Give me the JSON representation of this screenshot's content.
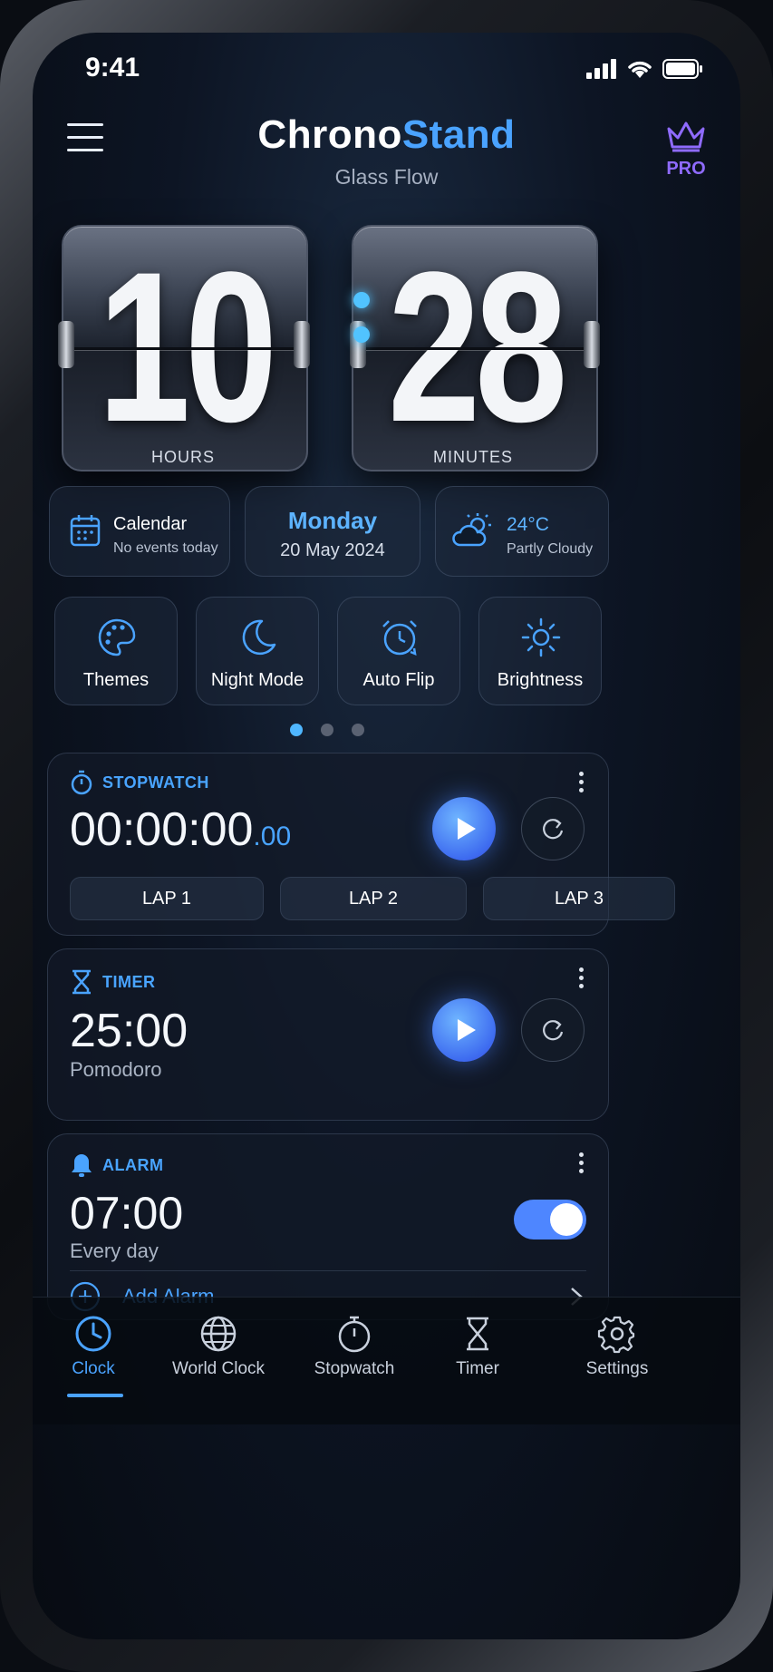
{
  "status_bar": {
    "time": "9:41"
  },
  "header": {
    "brand_part1": "Chrono",
    "brand_part2": "Stand",
    "subtitle": "Glass Flow",
    "pro_label": "PRO"
  },
  "clock": {
    "hours": "10",
    "minutes": "28",
    "hours_label": "HOURS",
    "minutes_label": "MINUTES"
  },
  "info_cards": {
    "calendar": {
      "title": "Calendar",
      "subtitle": "No events today"
    },
    "date": {
      "day": "Monday",
      "date": "20 May 2024"
    },
    "weather": {
      "temp": "24°C",
      "condition": "Partly Cloudy"
    }
  },
  "quick_actions": [
    {
      "label": "Themes",
      "icon": "palette-icon"
    },
    {
      "label": "Night Mode",
      "icon": "moon-icon"
    },
    {
      "label": "Auto Flip",
      "icon": "auto-flip-icon"
    },
    {
      "label": "Brightness",
      "icon": "sun-icon"
    }
  ],
  "pager": {
    "pages": 3,
    "active": 1
  },
  "stopwatch": {
    "title": "STOPWATCH",
    "time": "00:00:00",
    "fraction": ".00",
    "laps": [
      "LAP 1",
      "LAP 2",
      "LAP 3"
    ]
  },
  "timer": {
    "title": "TIMER",
    "time": "25:00",
    "preset": "Pomodoro"
  },
  "alarm": {
    "title": "ALARM",
    "time": "07:00",
    "repeat": "Every day",
    "enabled": true,
    "add_label": "Add Alarm"
  },
  "tabs": [
    {
      "label": "Clock",
      "icon": "clock-icon",
      "active": true
    },
    {
      "label": "World Clock",
      "icon": "globe-icon",
      "active": false
    },
    {
      "label": "Stopwatch",
      "icon": "stopwatch-icon",
      "active": false
    },
    {
      "label": "Timer",
      "icon": "hourglass-icon",
      "active": false
    },
    {
      "label": "Settings",
      "icon": "gear-icon",
      "active": false
    }
  ],
  "colors": {
    "accent": "#4aa3ff",
    "pro": "#8f6bff",
    "play": "#4e86ff"
  }
}
